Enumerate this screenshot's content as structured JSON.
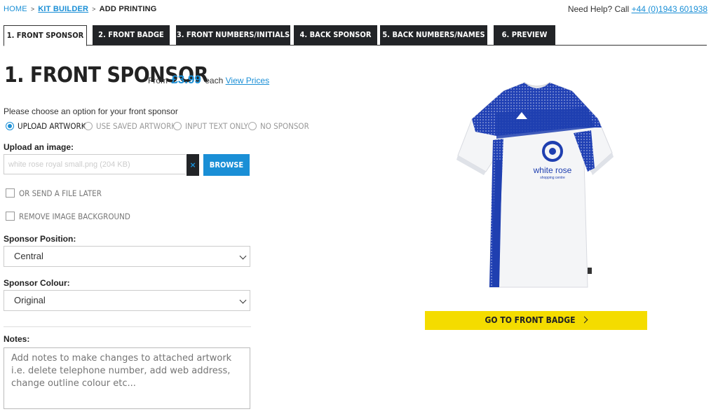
{
  "breadcrumb": {
    "home": "HOME",
    "kit_builder": "KIT BUILDER",
    "current": "ADD PRINTING"
  },
  "help": {
    "text": "Need Help? Call",
    "phone": "+44 (0)1943 601938"
  },
  "tabs": [
    {
      "label": "1. FRONT SPONSOR"
    },
    {
      "label": "2. FRONT BADGE"
    },
    {
      "label": "3. FRONT NUMBERS/INITIALS"
    },
    {
      "label": "4. BACK SPONSOR"
    },
    {
      "label": "5. BACK NUMBERS/NAMES"
    },
    {
      "label": "6. PREVIEW"
    }
  ],
  "heading": {
    "title": "1. FRONT SPONSOR",
    "from": "From",
    "price": "£3.99",
    "each": "each",
    "view_prices": "View Prices"
  },
  "prompt": "Please choose an option for your front sponsor",
  "options": [
    {
      "label": "UPLOAD ARTWORK",
      "selected": true
    },
    {
      "label": "USE SAVED ARTWORK",
      "selected": false
    },
    {
      "label": "INPUT TEXT ONLY",
      "selected": false
    },
    {
      "label": "NO SPONSOR",
      "selected": false
    }
  ],
  "upload": {
    "label": "Upload an image:",
    "filename": "white rose royal small.png (204 KB)",
    "clear": "×",
    "browse": "BROWSE"
  },
  "checks": {
    "send_later": "OR SEND A FILE LATER",
    "remove_bg": "REMOVE IMAGE BACKGROUND"
  },
  "position": {
    "label": "Sponsor Position:",
    "value": "Central"
  },
  "colour": {
    "label": "Sponsor Colour:",
    "value": "Original"
  },
  "notes": {
    "label": "Notes:",
    "placeholder": "Add notes to make changes to attached artwork i.e. delete telephone number, add web address, change outline colour etc..."
  },
  "shirt": {
    "sponsor_name": "white rose",
    "sponsor_sub": "shopping centre"
  },
  "cta": {
    "label": "GO TO FRONT BADGE"
  },
  "colors": {
    "accent": "#1a8fd6",
    "dark": "#222427",
    "cta": "#f4dc00",
    "shirt_blue": "#1f3fb0"
  }
}
